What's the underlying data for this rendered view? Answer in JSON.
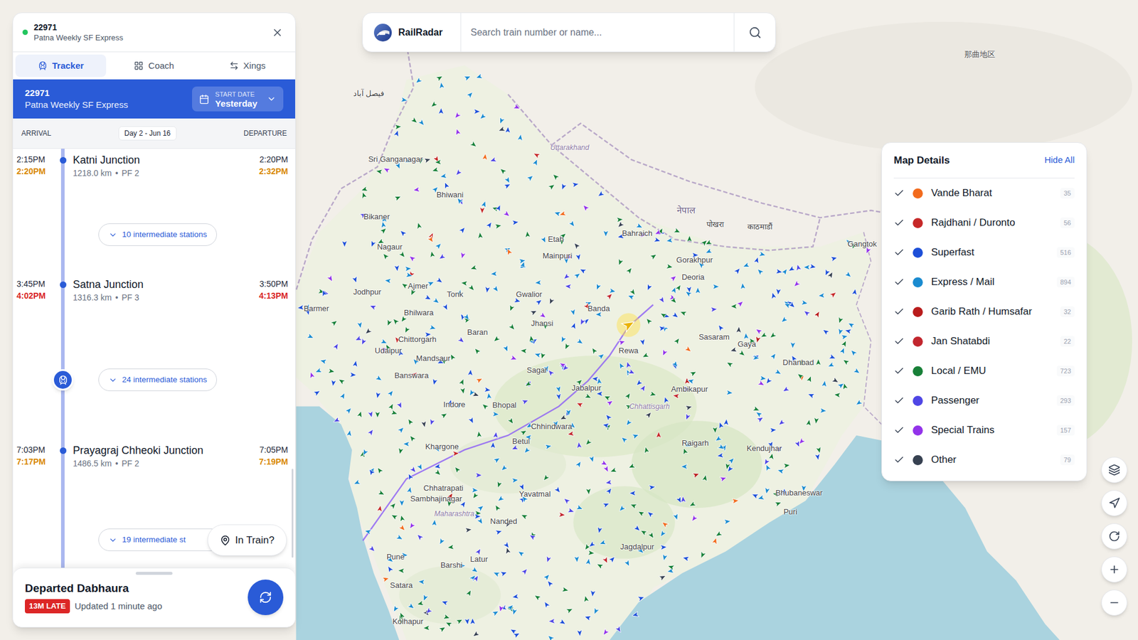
{
  "train": {
    "number": "22971",
    "name": "Patna Weekly SF Express",
    "live": true
  },
  "tabs": [
    {
      "label": "Tracker",
      "selected": true
    },
    {
      "label": "Coach",
      "selected": false
    },
    {
      "label": "Xings",
      "selected": false
    }
  ],
  "banner": {
    "number": "22971",
    "name": "Patna Weekly SF Express",
    "start_date_label": "START DATE",
    "start_date": "Yesterday"
  },
  "columns": {
    "arrival": "ARRIVAL",
    "day": "Day 2 - Jun 16",
    "departure": "DEPARTURE"
  },
  "stations": [
    {
      "name": "Katni Junction",
      "distance": "1218.0 km",
      "separator": "•",
      "platform": "PF 2",
      "arrival_scheduled": "2:15PM",
      "arrival_actual": "2:20PM",
      "arrival_color": "#d98a06",
      "departure_scheduled": "2:20PM",
      "departure_actual": "2:32PM",
      "departure_color": "#d98a06",
      "intermediate": "10 intermediate stations",
      "train_here": false
    },
    {
      "name": "Satna Junction",
      "distance": "1316.3 km",
      "separator": "•",
      "platform": "PF 3",
      "arrival_scheduled": "3:45PM",
      "arrival_actual": "4:02PM",
      "arrival_color": "#d92626",
      "departure_scheduled": "3:50PM",
      "departure_actual": "4:13PM",
      "departure_color": "#d92626",
      "intermediate": "24 intermediate stations",
      "train_here": true
    },
    {
      "name": "Prayagraj Chheoki Junction",
      "distance": "1486.5 km",
      "separator": "•",
      "platform": "PF 2",
      "arrival_scheduled": "7:03PM",
      "arrival_actual": "7:17PM",
      "arrival_color": "#d98a06",
      "departure_scheduled": "7:05PM",
      "departure_actual": "7:19PM",
      "departure_color": "#d98a06",
      "intermediate": "19 intermediate st",
      "train_here": false
    }
  ],
  "in_train_button": "In Train?",
  "status": {
    "text": "Departed Dabhaura",
    "late": "13M LATE",
    "updated": "Updated 1 minute ago"
  },
  "search": {
    "brand": "RailRadar",
    "placeholder": "Search train number or name..."
  },
  "map_details": {
    "title": "Map Details",
    "hide_all": "Hide All",
    "categories": [
      {
        "label": "Vande Bharat",
        "count": "35",
        "color": "#f26b1d",
        "checked": true
      },
      {
        "label": "Rajdhani / Duronto",
        "count": "56",
        "color": "#c62828",
        "checked": true
      },
      {
        "label": "Superfast",
        "count": "516",
        "color": "#1d4fd8",
        "checked": true
      },
      {
        "label": "Express / Mail",
        "count": "894",
        "color": "#1a8bd0",
        "checked": true
      },
      {
        "label": "Garib Rath / Humsafar",
        "count": "32",
        "color": "#b91c1c",
        "checked": true
      },
      {
        "label": "Jan Shatabdi",
        "count": "22",
        "color": "#c2262e",
        "checked": true
      },
      {
        "label": "Local / EMU",
        "count": "723",
        "color": "#188038",
        "checked": true
      },
      {
        "label": "Passenger",
        "count": "293",
        "color": "#4f46e5",
        "checked": true
      },
      {
        "label": "Special Trains",
        "count": "157",
        "color": "#9333ea",
        "checked": true
      },
      {
        "label": "Other",
        "count": "79",
        "color": "#374151",
        "checked": true
      }
    ]
  },
  "map_labels": [
    {
      "text": "Sri Ganganagar",
      "kind": "city"
    },
    {
      "text": "Bhiwani",
      "kind": "city"
    },
    {
      "text": "Bikaner",
      "kind": "city"
    },
    {
      "text": "Nagaur",
      "kind": "city"
    },
    {
      "text": "Jodhpur",
      "kind": "city"
    },
    {
      "text": "Ajmer",
      "kind": "city"
    },
    {
      "text": "Tonk",
      "kind": "city"
    },
    {
      "text": "Barmer",
      "kind": "city"
    },
    {
      "text": "Bhilwara",
      "kind": "city"
    },
    {
      "text": "Chittorgarh",
      "kind": "city"
    },
    {
      "text": "Udaipur",
      "kind": "city"
    },
    {
      "text": "Mandsaur",
      "kind": "city"
    },
    {
      "text": "Banswara",
      "kind": "city"
    },
    {
      "text": "Baran",
      "kind": "city"
    },
    {
      "text": "Gwalior",
      "kind": "city"
    },
    {
      "text": "Jhansi",
      "kind": "city"
    },
    {
      "text": "Etah",
      "kind": "city"
    },
    {
      "text": "Mainpuri",
      "kind": "city"
    },
    {
      "text": "Bahraich",
      "kind": "city"
    },
    {
      "text": "Gorakhpur",
      "kind": "city"
    },
    {
      "text": "Deoria",
      "kind": "city"
    },
    {
      "text": "Banda",
      "kind": "city"
    },
    {
      "text": "Rewa",
      "kind": "city"
    },
    {
      "text": "Sasaram",
      "kind": "city"
    },
    {
      "text": "Gaya",
      "kind": "city"
    },
    {
      "text": "Sagar",
      "kind": "city"
    },
    {
      "text": "Jabalpur",
      "kind": "city"
    },
    {
      "text": "Ambikapur",
      "kind": "city"
    },
    {
      "text": "Bhopal",
      "kind": "city"
    },
    {
      "text": "Indore",
      "kind": "city"
    },
    {
      "text": "Chhindwara",
      "kind": "city"
    },
    {
      "text": "Raigarh",
      "kind": "city"
    },
    {
      "text": "Kendujhar",
      "kind": "city"
    },
    {
      "text": "Betul",
      "kind": "city"
    },
    {
      "text": "Khargone",
      "kind": "city"
    },
    {
      "text": "Chhatrapati",
      "kind": "city"
    },
    {
      "text": "Sambhajinagar",
      "kind": "city"
    },
    {
      "text": "Yavatmal",
      "kind": "city"
    },
    {
      "text": "Nanded",
      "kind": "city"
    },
    {
      "text": "Jagdalpur",
      "kind": "city"
    },
    {
      "text": "Bhubaneswar",
      "kind": "city"
    },
    {
      "text": "Puri",
      "kind": "city"
    },
    {
      "text": "Pune",
      "kind": "city"
    },
    {
      "text": "Latur",
      "kind": "city"
    },
    {
      "text": "Barshi",
      "kind": "city"
    },
    {
      "text": "Satara",
      "kind": "city"
    },
    {
      "text": "Kolhapur",
      "kind": "city"
    },
    {
      "text": "Gangtok",
      "kind": "city"
    },
    {
      "text": "Dhanbad",
      "kind": "city"
    },
    {
      "text": "Uttarakhand",
      "kind": "region"
    },
    {
      "text": "Chhattisgarh",
      "kind": "region"
    },
    {
      "text": "Maharashtra",
      "kind": "region"
    },
    {
      "text": "नेपाल",
      "kind": "country"
    },
    {
      "text": "पोखरा",
      "kind": "city"
    },
    {
      "text": "काठमाडौं",
      "kind": "city"
    },
    {
      "text": "فیصل آباد",
      "kind": "city"
    },
    {
      "text": "那曲地区",
      "kind": "city"
    }
  ]
}
